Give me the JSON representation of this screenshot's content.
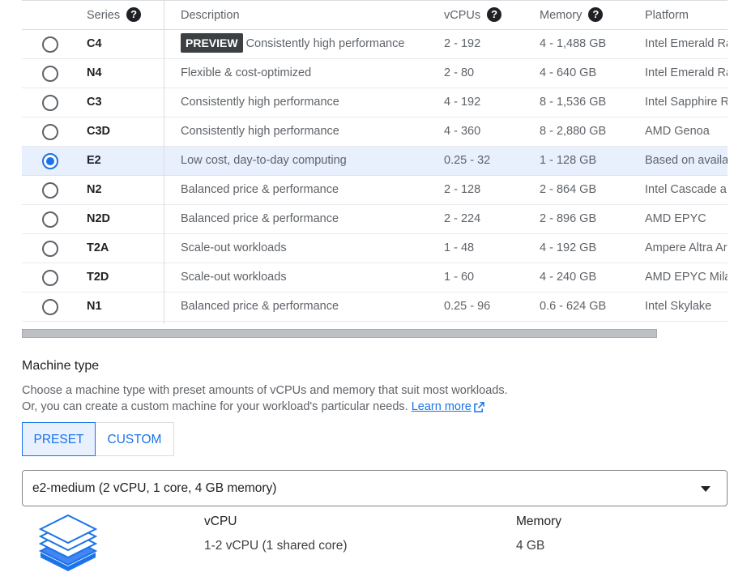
{
  "table": {
    "headers": {
      "series": "Series",
      "description": "Description",
      "vcpus": "vCPUs",
      "memory": "Memory",
      "platform": "Platform"
    },
    "rows": [
      {
        "series": "C4",
        "badge": "PREVIEW",
        "description": "Consistently high performance",
        "vcpus": "2 - 192",
        "memory": "4 - 1,488 GB",
        "platform": "Intel Emerald Ra",
        "selected": false
      },
      {
        "series": "N4",
        "badge": "",
        "description": "Flexible & cost-optimized",
        "vcpus": "2 - 80",
        "memory": "4 - 640 GB",
        "platform": "Intel Emerald Ra",
        "selected": false
      },
      {
        "series": "C3",
        "badge": "",
        "description": "Consistently high performance",
        "vcpus": "4 - 192",
        "memory": "8 - 1,536 GB",
        "platform": "Intel Sapphire R",
        "selected": false
      },
      {
        "series": "C3D",
        "badge": "",
        "description": "Consistently high performance",
        "vcpus": "4 - 360",
        "memory": "8 - 2,880 GB",
        "platform": "AMD Genoa",
        "selected": false
      },
      {
        "series": "E2",
        "badge": "",
        "description": "Low cost, day-to-day computing",
        "vcpus": "0.25 - 32",
        "memory": "1 - 128 GB",
        "platform": "Based on availa",
        "selected": true
      },
      {
        "series": "N2",
        "badge": "",
        "description": "Balanced price & performance",
        "vcpus": "2 - 128",
        "memory": "2 - 864 GB",
        "platform": "Intel Cascade a",
        "selected": false
      },
      {
        "series": "N2D",
        "badge": "",
        "description": "Balanced price & performance",
        "vcpus": "2 - 224",
        "memory": "2 - 896 GB",
        "platform": "AMD EPYC",
        "selected": false
      },
      {
        "series": "T2A",
        "badge": "",
        "description": "Scale-out workloads",
        "vcpus": "1 - 48",
        "memory": "4 - 192 GB",
        "platform": "Ampere Altra Ar",
        "selected": false
      },
      {
        "series": "T2D",
        "badge": "",
        "description": "Scale-out workloads",
        "vcpus": "1 - 60",
        "memory": "4 - 240 GB",
        "platform": "AMD EPYC Mila",
        "selected": false
      },
      {
        "series": "N1",
        "badge": "",
        "description": "Balanced price & performance",
        "vcpus": "0.25 - 96",
        "memory": "0.6 - 624 GB",
        "platform": "Intel Skylake",
        "selected": false
      }
    ]
  },
  "machine_type": {
    "title": "Machine type",
    "desc_line1": "Choose a machine type with preset amounts of vCPUs and memory that suit most workloads.",
    "desc_line2": "Or, you can create a custom machine for your workload's particular needs.",
    "learn_more": "Learn more",
    "preset_label": "PRESET",
    "custom_label": "CUSTOM",
    "selected_value": "e2-medium (2 vCPU, 1 core, 4 GB memory)",
    "vcpu_heading": "vCPU",
    "vcpu_value": "1-2 vCPU (1 shared core)",
    "memory_heading": "Memory",
    "memory_value": "4 GB"
  },
  "colors": {
    "accent": "#1a73e8",
    "selected_row_bg": "#e8f0fe",
    "badge_bg": "#3c4043"
  },
  "icons": [
    "help-icon",
    "radio-button",
    "external-link-icon",
    "dropdown-caret-icon",
    "machine-stack-icon"
  ]
}
